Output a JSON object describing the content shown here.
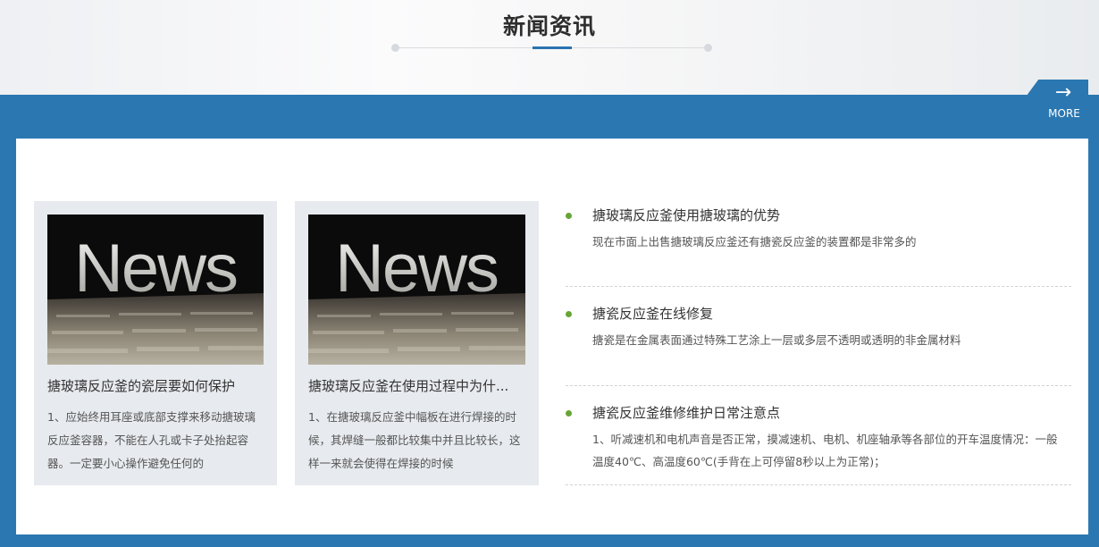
{
  "section": {
    "title": "新闻资讯",
    "more_label": "MORE",
    "more_arrow": "→"
  },
  "featured": [
    {
      "image_text": "News",
      "title": "搪玻璃反应釜的瓷层要如何保护",
      "excerpt": "1、应始终用耳座或底部支撑来移动搪玻璃反应釜容器，不能在人孔或卡子处抬起容器。一定要小心操作避免任何的"
    },
    {
      "image_text": "News",
      "title": "搪玻璃反应釜在使用过程中为什...",
      "excerpt": "1、在搪玻璃反应釜中幅板在进行焊接的时候，其焊缝一般都比较集中并且比较长，这样一来就会使得在焊接的时候"
    }
  ],
  "news_list": [
    {
      "title": "搪玻璃反应釜使用搪玻璃的优势",
      "desc": "现在市面上出售搪玻璃反应釜还有搪瓷反应釜的装置都是非常多的"
    },
    {
      "title": "搪瓷反应釜在线修复",
      "desc": "搪瓷是在金属表面通过特殊工艺涂上一层或多层不透明或透明的非金属材料"
    },
    {
      "title": "搪瓷反应釜维修维护日常注意点",
      "desc": "1、听减速机和电机声音是否正常，摸减速机、电机、机座轴承等各部位的开车温度情况：一般温度40℃、高温度60℃(手背在上可停留8秒以上为正常)；"
    }
  ],
  "colors": {
    "accent_blue": "#2b77b1",
    "bullet_green": "#66a535",
    "card_bg": "#e7eaee"
  }
}
